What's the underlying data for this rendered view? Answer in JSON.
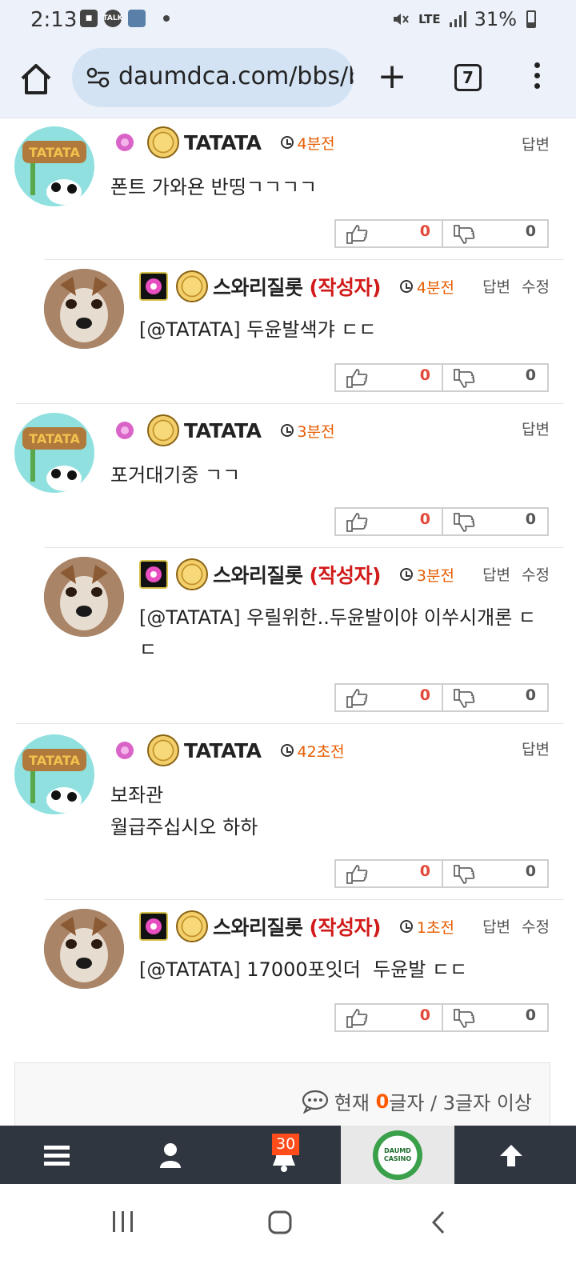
{
  "status_bar": {
    "time": "2:13",
    "notif_icons": [
      "message-icon",
      "kakaotalk-icon",
      "app-icon"
    ],
    "network": "LTE",
    "battery": "31%"
  },
  "browser": {
    "url": "daumdca.com/bbs/b",
    "tab_count": "7"
  },
  "comments": [
    {
      "nickname": "TATATA",
      "author_tag": "",
      "time": "4분전",
      "actions": [
        "답변"
      ],
      "text": "폰트 가와욘 반띵ㄱㄱㄱㄱ",
      "likes": "0",
      "dislikes": "0"
    },
    {
      "nickname": "스와리질롯",
      "author_tag": "(작성자)",
      "time": "4분전",
      "actions": [
        "답변",
        "수정"
      ],
      "text": "[@TATATA] 두윤발색갸 ㄷㄷ",
      "likes": "0",
      "dislikes": "0"
    },
    {
      "nickname": "TATATA",
      "author_tag": "",
      "time": "3분전",
      "actions": [
        "답변"
      ],
      "text": "포거대기중 ㄱㄱ",
      "likes": "0",
      "dislikes": "0"
    },
    {
      "nickname": "스와리질롯",
      "author_tag": "(작성자)",
      "time": "3분전",
      "actions": [
        "답변",
        "수정"
      ],
      "text": "[@TATATA] 우릴위한..두윤발이야 이쑤시개론 ㄷ\nㄷ",
      "likes": "0",
      "dislikes": "0"
    },
    {
      "nickname": "TATATA",
      "author_tag": "",
      "time": "42초전",
      "actions": [
        "답변"
      ],
      "text": "보좌관\n월급주십시오 하하",
      "likes": "0",
      "dislikes": "0"
    },
    {
      "nickname": "스와리질롯",
      "author_tag": "(작성자)",
      "time": "1초전",
      "actions": [
        "답변",
        "수정"
      ],
      "text": "[@TATATA] 17000포잇더  두윤발 ㄷㄷ",
      "likes": "0",
      "dislikes": "0"
    }
  ],
  "input": {
    "prefix": "현재 ",
    "count": "0",
    "suffix": "글자 / 3글자 이상"
  },
  "site_nav": {
    "notification_badge": "30",
    "casino_logo_text": "DAUMD CASINO"
  },
  "colors": {
    "time": "#e55b00",
    "author_tag": "#d11a1a",
    "like_count": "#e04a3a",
    "nav_bg": "#2f3640",
    "badge": "#ff4c1a"
  }
}
